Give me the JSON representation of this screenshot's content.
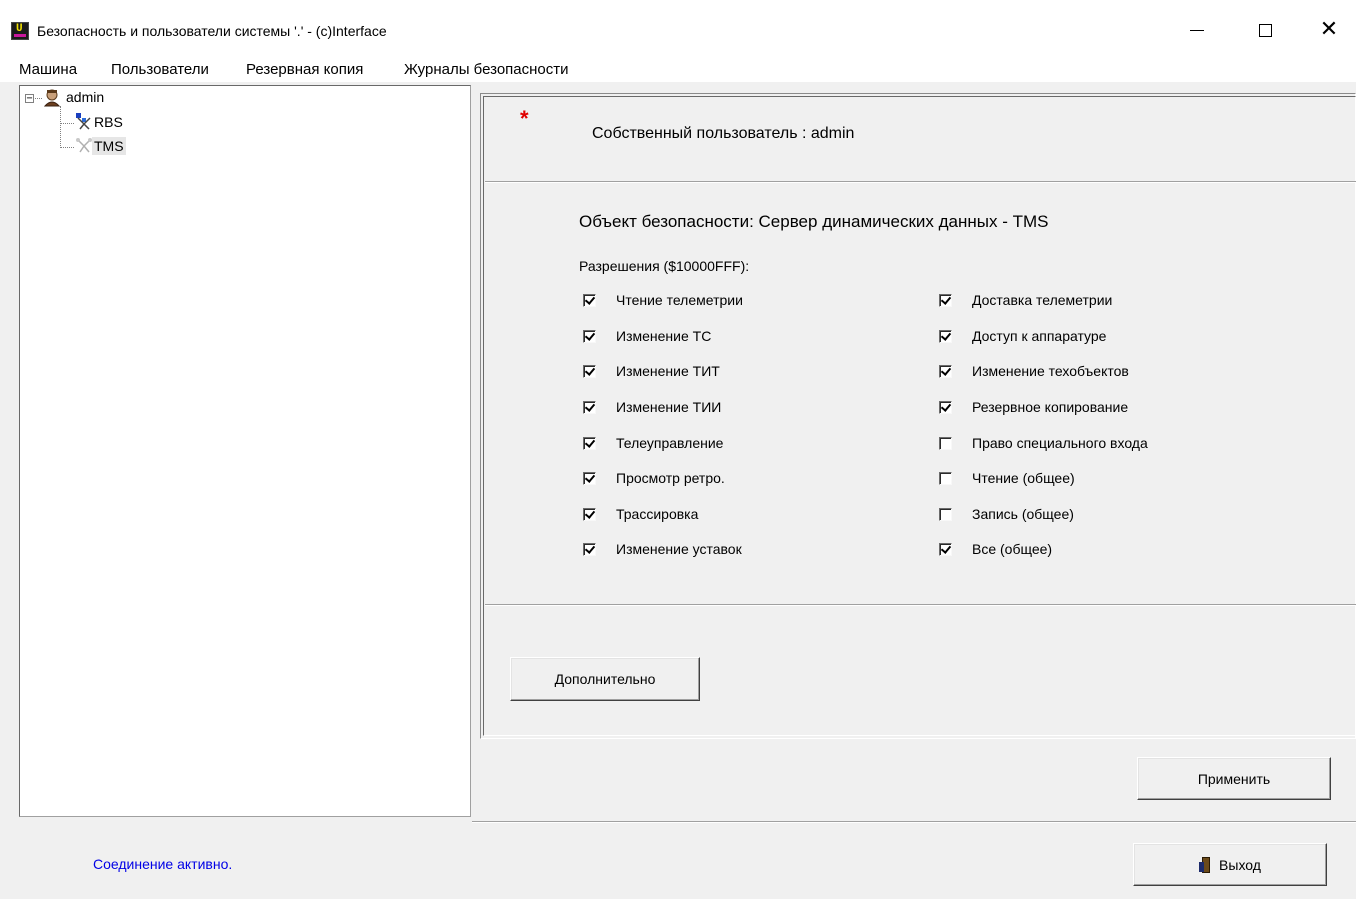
{
  "window": {
    "title": "Безопасность и пользователи системы '.' - (c)Interface",
    "app_icon": "u-app-icon"
  },
  "menu": {
    "items": [
      "Машина",
      "Пользователи",
      "Резервная копия",
      "Журналы безопасности"
    ]
  },
  "tree": {
    "root": {
      "label": "admin",
      "icon": "user-icon",
      "expander": "⊟"
    },
    "children": [
      {
        "label": "RBS",
        "icon": "network-icon"
      },
      {
        "label": "TMS",
        "icon": "network-icon-faded",
        "selected": true
      }
    ]
  },
  "header": {
    "asterisk": "*",
    "owner_label": "Собственный пользователь :  admin"
  },
  "security_object": {
    "label": "Объект безопасности: Сервер динамических данных - TMS",
    "permissions_label": "Разрешения ($10000FFF):"
  },
  "permissions_left": [
    {
      "label": "Чтение телеметрии",
      "checked": true
    },
    {
      "label": "Изменение ТС",
      "checked": true
    },
    {
      "label": "Изменение ТИТ",
      "checked": true
    },
    {
      "label": "Изменение ТИИ",
      "checked": true
    },
    {
      "label": "Телеуправление",
      "checked": true
    },
    {
      "label": "Просмотр ретро.",
      "checked": true
    },
    {
      "label": "Трассировка",
      "checked": true
    },
    {
      "label": "Изменение уставок",
      "checked": true
    }
  ],
  "permissions_right": [
    {
      "label": "Доставка телеметрии",
      "checked": true
    },
    {
      "label": "Доступ к аппаратуре",
      "checked": true
    },
    {
      "label": "Изменение техобъектов",
      "checked": true
    },
    {
      "label": "Резервное копирование",
      "checked": true
    },
    {
      "label": "Право специального входа",
      "checked": false
    },
    {
      "label": "Чтение (общее)",
      "checked": false
    },
    {
      "label": "Запись (общее)",
      "checked": false
    },
    {
      "label": "Все (общее)",
      "checked": true
    }
  ],
  "buttons": {
    "more": "Дополнительно",
    "apply": "Применить",
    "exit": "Выход"
  },
  "status": {
    "text": "Соединение активно.",
    "color": "#0000e6"
  },
  "colors": {
    "asterisk": "#e00000"
  }
}
